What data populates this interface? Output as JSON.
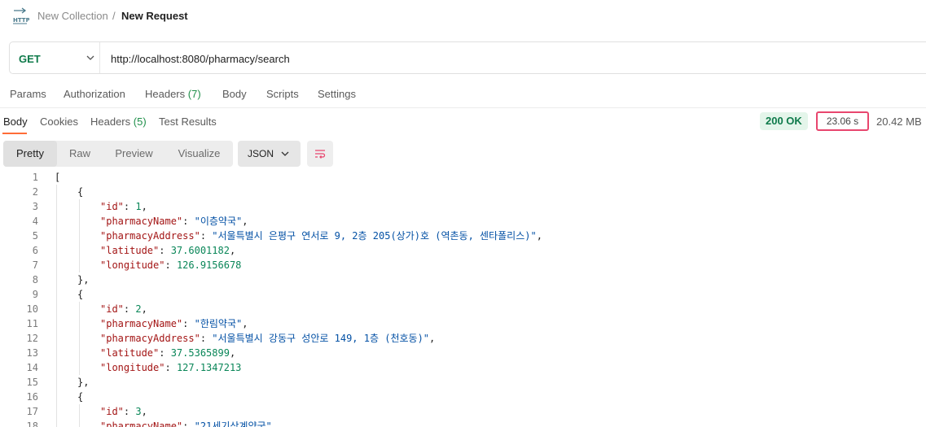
{
  "header": {
    "icon": "http-icon",
    "breadcrumb_collection": "New Collection",
    "breadcrumb_sep": "/",
    "breadcrumb_request": "New Request"
  },
  "request": {
    "method": "GET",
    "url": "http://localhost:8080/pharmacy/search"
  },
  "request_tabs": {
    "params": "Params",
    "authorization": "Authorization",
    "headers": "Headers",
    "headers_count": "(7)",
    "body": "Body",
    "scripts": "Scripts",
    "settings": "Settings"
  },
  "response_tabs": {
    "body": "Body",
    "cookies": "Cookies",
    "headers": "Headers",
    "headers_count": "(5)",
    "test_results": "Test Results"
  },
  "response_meta": {
    "status": "200 OK",
    "time": "23.06 s",
    "size": "20.42 MB"
  },
  "view_modes": {
    "pretty": "Pretty",
    "raw": "Raw",
    "preview": "Preview",
    "visualize": "Visualize",
    "format": "JSON"
  },
  "colors": {
    "accent": "#ff6c37",
    "status_ok_bg": "#e4f5ea",
    "status_ok_text": "#0e7a4a",
    "highlight_border": "#e8466e",
    "json_key": "#a31515",
    "json_string": "#0451a5",
    "json_number": "#098658"
  },
  "code_lines": [
    {
      "n": "1",
      "indent": 0,
      "parts": [
        {
          "t": "[",
          "c": "punc"
        }
      ]
    },
    {
      "n": "2",
      "indent": 1,
      "parts": [
        {
          "t": "{",
          "c": "punc"
        }
      ]
    },
    {
      "n": "3",
      "indent": 2,
      "parts": [
        {
          "t": "\"id\"",
          "c": "key"
        },
        {
          "t": ": ",
          "c": "punc"
        },
        {
          "t": "1",
          "c": "num"
        },
        {
          "t": ",",
          "c": "punc"
        }
      ]
    },
    {
      "n": "4",
      "indent": 2,
      "parts": [
        {
          "t": "\"pharmacyName\"",
          "c": "key"
        },
        {
          "t": ": ",
          "c": "punc"
        },
        {
          "t": "\"이층약국\"",
          "c": "str"
        },
        {
          "t": ",",
          "c": "punc"
        }
      ]
    },
    {
      "n": "5",
      "indent": 2,
      "parts": [
        {
          "t": "\"pharmacyAddress\"",
          "c": "key"
        },
        {
          "t": ": ",
          "c": "punc"
        },
        {
          "t": "\"서울특별시 은평구 연서로 9, 2층 205(상가)호 (역촌동, 센타폴리스)\"",
          "c": "str"
        },
        {
          "t": ",",
          "c": "punc"
        }
      ]
    },
    {
      "n": "6",
      "indent": 2,
      "parts": [
        {
          "t": "\"latitude\"",
          "c": "key"
        },
        {
          "t": ": ",
          "c": "punc"
        },
        {
          "t": "37.6001182",
          "c": "num"
        },
        {
          "t": ",",
          "c": "punc"
        }
      ]
    },
    {
      "n": "7",
      "indent": 2,
      "parts": [
        {
          "t": "\"longitude\"",
          "c": "key"
        },
        {
          "t": ": ",
          "c": "punc"
        },
        {
          "t": "126.9156678",
          "c": "num"
        }
      ]
    },
    {
      "n": "8",
      "indent": 1,
      "parts": [
        {
          "t": "},",
          "c": "punc"
        }
      ]
    },
    {
      "n": "9",
      "indent": 1,
      "parts": [
        {
          "t": "{",
          "c": "punc"
        }
      ]
    },
    {
      "n": "10",
      "indent": 2,
      "parts": [
        {
          "t": "\"id\"",
          "c": "key"
        },
        {
          "t": ": ",
          "c": "punc"
        },
        {
          "t": "2",
          "c": "num"
        },
        {
          "t": ",",
          "c": "punc"
        }
      ]
    },
    {
      "n": "11",
      "indent": 2,
      "parts": [
        {
          "t": "\"pharmacyName\"",
          "c": "key"
        },
        {
          "t": ": ",
          "c": "punc"
        },
        {
          "t": "\"한림약국\"",
          "c": "str"
        },
        {
          "t": ",",
          "c": "punc"
        }
      ]
    },
    {
      "n": "12",
      "indent": 2,
      "parts": [
        {
          "t": "\"pharmacyAddress\"",
          "c": "key"
        },
        {
          "t": ": ",
          "c": "punc"
        },
        {
          "t": "\"서울특별시 강동구 성안로 149, 1층 (천호동)\"",
          "c": "str"
        },
        {
          "t": ",",
          "c": "punc"
        }
      ]
    },
    {
      "n": "13",
      "indent": 2,
      "parts": [
        {
          "t": "\"latitude\"",
          "c": "key"
        },
        {
          "t": ": ",
          "c": "punc"
        },
        {
          "t": "37.5365899",
          "c": "num"
        },
        {
          "t": ",",
          "c": "punc"
        }
      ]
    },
    {
      "n": "14",
      "indent": 2,
      "parts": [
        {
          "t": "\"longitude\"",
          "c": "key"
        },
        {
          "t": ": ",
          "c": "punc"
        },
        {
          "t": "127.1347213",
          "c": "num"
        }
      ]
    },
    {
      "n": "15",
      "indent": 1,
      "parts": [
        {
          "t": "},",
          "c": "punc"
        }
      ]
    },
    {
      "n": "16",
      "indent": 1,
      "parts": [
        {
          "t": "{",
          "c": "punc"
        }
      ]
    },
    {
      "n": "17",
      "indent": 2,
      "parts": [
        {
          "t": "\"id\"",
          "c": "key"
        },
        {
          "t": ": ",
          "c": "punc"
        },
        {
          "t": "3",
          "c": "num"
        },
        {
          "t": ",",
          "c": "punc"
        }
      ]
    },
    {
      "n": "18",
      "indent": 2,
      "parts": [
        {
          "t": "\"pharmacyName\"",
          "c": "key"
        },
        {
          "t": ": ",
          "c": "punc"
        },
        {
          "t": "\"21세기상계약국\"",
          "c": "str"
        },
        {
          "t": ",",
          "c": "punc"
        }
      ]
    }
  ]
}
